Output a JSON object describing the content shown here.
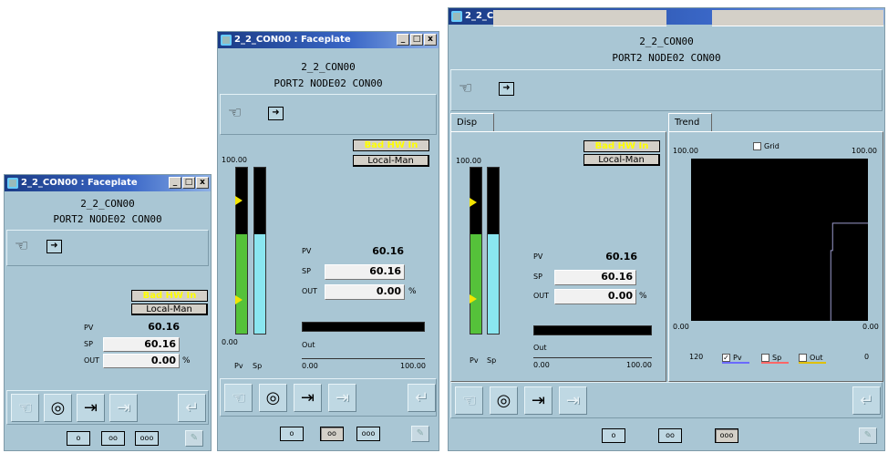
{
  "window_title": "2_2_CON00 : Faceplate",
  "titlebar_buttons": {
    "minimize": "_",
    "maximize": "□",
    "close": "x"
  },
  "tag_name": "2_2_CON00",
  "tag_desc": "PORT2 NODE02 CON00",
  "status": {
    "bad_hw": "Bad HW In",
    "mode": "Local-Man"
  },
  "labels": {
    "pv": "PV",
    "sp": "SP",
    "out": "OUT",
    "out_scale": "Out",
    "bar_pv": "Pv",
    "bar_sp": "Sp",
    "percent": "%"
  },
  "values": {
    "pv": "60.16",
    "sp": "60.16",
    "out": "0.00"
  },
  "ranges": {
    "hi": "100.00",
    "lo": "0.00",
    "out_lo": "0.00",
    "out_hi": "100.00"
  },
  "levels": {
    "pv_fraction": 0.6016,
    "sp_fraction": 0.6016,
    "out_fraction": 0.0
  },
  "view_buttons": [
    "o",
    "oo",
    "ooo"
  ],
  "tabs": {
    "disp": "Disp",
    "trend": "Trend"
  },
  "trend": {
    "grid_label": "Grid",
    "y_hi": "100.00",
    "y_lo": "0.00",
    "y_hi_right": "100.00",
    "y_lo_right": "0.00",
    "x_left": "120",
    "x_right": "0",
    "legend": [
      {
        "label": "Pv",
        "checked": true,
        "color": "#6a6aff"
      },
      {
        "label": "Sp",
        "checked": false,
        "color": "#ff6666"
      },
      {
        "label": "Out",
        "checked": false,
        "color": "#e0c000"
      }
    ]
  },
  "colors": {
    "pv_bar": "#55c23a",
    "sp_bar": "#8ae6f0",
    "panel_bg": "#a9c6d4",
    "bad_hw": "#ffff00"
  },
  "icons": [
    "hand-icon",
    "enter-icon",
    "mode-spiral-icon",
    "tune-icon",
    "pin-icon",
    "return-icon"
  ]
}
